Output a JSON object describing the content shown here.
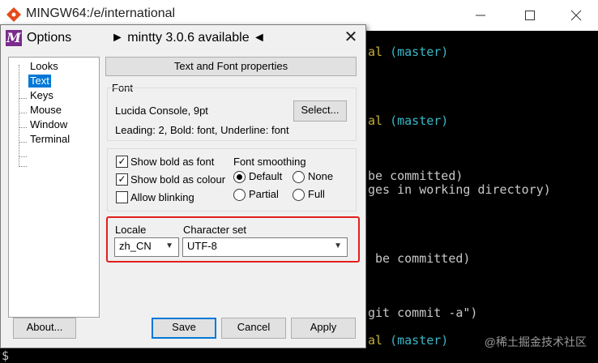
{
  "terminal": {
    "title": "MINGW64:/e/international",
    "lines": [
      {
        "pre": "al ",
        "branch": "(master)"
      },
      {
        "pre": "al ",
        "branch": "(master)"
      },
      {
        "pre": "be committed)",
        "branch": ""
      },
      {
        "pre": "ges in working directory)",
        "branch": ""
      },
      {
        "pre": " be committed)",
        "branch": ""
      },
      {
        "pre": "git commit -a\")",
        "branch": ""
      },
      {
        "pre": "al ",
        "branch": "(master)"
      }
    ],
    "prompt": "$",
    "watermark": "@稀土掘金技术社区"
  },
  "dialog": {
    "title": "Options",
    "subtitle": "► mintty 3.0.6 available ◄",
    "close": "✕",
    "tree": [
      "Looks",
      "Text",
      "Keys",
      "Mouse",
      "Window",
      "Terminal"
    ],
    "selected_tree": "Text",
    "section_button": "Text and Font properties",
    "font_group": {
      "label": "Font",
      "name": "Lucida Console, 9pt",
      "select_button": "Select...",
      "details": "Leading: 2, Bold: font, Underline: font"
    },
    "checks": [
      {
        "label": "Show bold as font",
        "checked": true
      },
      {
        "label": "Show bold as colour",
        "checked": true
      },
      {
        "label": "Allow blinking",
        "checked": false
      }
    ],
    "smoothing": {
      "label": "Font smoothing",
      "options": [
        {
          "label": "Default",
          "selected": true
        },
        {
          "label": "None",
          "selected": false
        },
        {
          "label": "Partial",
          "selected": false
        },
        {
          "label": "Full",
          "selected": false
        }
      ]
    },
    "locale": {
      "label": "Locale",
      "value": "zh_CN"
    },
    "charset": {
      "label": "Character set",
      "value": "UTF-8"
    },
    "buttons": {
      "about": "About...",
      "save": "Save",
      "cancel": "Cancel",
      "apply": "Apply"
    },
    "colors": {
      "accent": "#0078d7",
      "highlight": "#e0201e"
    }
  }
}
